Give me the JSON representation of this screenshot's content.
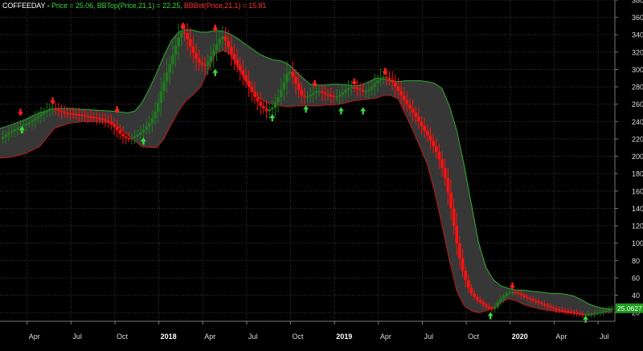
{
  "chart_data": {
    "type": "candlestick",
    "symbol": "COFFEEDAY",
    "legend": [
      {
        "key": "symbol",
        "text": "COFFEEDAY",
        "color": "#ffffff"
      },
      {
        "key": "sep",
        "text": " - ",
        "color": "#ffffff"
      },
      {
        "key": "price",
        "text": "Price = 25.06, ",
        "color": "#3fd43f"
      },
      {
        "key": "bbtop",
        "text": "BBTop(Price,21,1) = 22.25, ",
        "color": "#3fd43f"
      },
      {
        "key": "bbbot",
        "text": "BBBot(Price,21,1) = 15.81",
        "color": "#ff3030"
      }
    ],
    "last_price_label": "25.0627",
    "y_axis": {
      "min": 10,
      "max": 380,
      "ticks": [
        20,
        40,
        60,
        80,
        100,
        120,
        140,
        160,
        180,
        200,
        220,
        240,
        260,
        280,
        300,
        320,
        340,
        360,
        380
      ]
    },
    "x_axis": {
      "ticks": [
        {
          "t": 0.15,
          "label": "Apr",
          "bold": false
        },
        {
          "t": 3.15,
          "label": "Jul",
          "bold": false
        },
        {
          "t": 6.15,
          "label": "Oct",
          "bold": false
        },
        {
          "t": 9.15,
          "label": "2018",
          "bold": true
        },
        {
          "t": 12.15,
          "label": "Apr",
          "bold": false
        },
        {
          "t": 15.15,
          "label": "Jul",
          "bold": false
        },
        {
          "t": 18.15,
          "label": "Oct",
          "bold": false
        },
        {
          "t": 21.15,
          "label": "2019",
          "bold": true
        },
        {
          "t": 24.15,
          "label": "Apr",
          "bold": false
        },
        {
          "t": 27.15,
          "label": "Jul",
          "bold": false
        },
        {
          "t": 30.15,
          "label": "Oct",
          "bold": false
        },
        {
          "t": 33.15,
          "label": "2020",
          "bold": true
        },
        {
          "t": 36.15,
          "label": "Apr",
          "bold": false
        },
        {
          "t": 39.15,
          "label": "Jul",
          "bold": false
        }
      ],
      "t_min": -1.7,
      "t_max": 40.3
    },
    "price": [
      [
        -1.7,
        220
      ],
      [
        -1.2,
        226
      ],
      [
        -0.6,
        232
      ],
      [
        -0.1,
        236
      ],
      [
        0.4,
        240
      ],
      [
        0.9,
        246
      ],
      [
        1.4,
        252
      ],
      [
        1.8,
        256
      ],
      [
        2.2,
        253
      ],
      [
        2.7,
        250
      ],
      [
        3.2,
        249
      ],
      [
        3.7,
        248
      ],
      [
        4.2,
        246
      ],
      [
        4.7,
        245
      ],
      [
        5.2,
        243
      ],
      [
        5.7,
        240
      ],
      [
        6.2,
        232
      ],
      [
        6.6,
        224
      ],
      [
        7.0,
        220
      ],
      [
        7.4,
        222
      ],
      [
        7.8,
        226
      ],
      [
        8.2,
        232
      ],
      [
        8.6,
        240
      ],
      [
        9.0,
        255
      ],
      [
        9.3,
        275
      ],
      [
        9.6,
        292
      ],
      [
        9.9,
        306
      ],
      [
        10.2,
        322
      ],
      [
        10.5,
        337
      ],
      [
        10.8,
        345
      ],
      [
        11.1,
        335
      ],
      [
        11.4,
        322
      ],
      [
        11.7,
        312
      ],
      [
        12.0,
        306
      ],
      [
        12.3,
        304
      ],
      [
        12.6,
        312
      ],
      [
        12.9,
        322
      ],
      [
        13.2,
        333
      ],
      [
        13.5,
        338
      ],
      [
        13.8,
        330
      ],
      [
        14.1,
        318
      ],
      [
        14.5,
        305
      ],
      [
        14.9,
        293
      ],
      [
        15.3,
        280
      ],
      [
        15.7,
        268
      ],
      [
        16.1,
        258
      ],
      [
        16.5,
        252
      ],
      [
        16.9,
        256
      ],
      [
        17.3,
        268
      ],
      [
        17.7,
        285
      ],
      [
        18.0,
        300
      ],
      [
        18.3,
        292
      ],
      [
        18.6,
        280
      ],
      [
        18.9,
        270
      ],
      [
        19.2,
        268
      ],
      [
        19.6,
        272
      ],
      [
        20.0,
        276
      ],
      [
        20.4,
        272
      ],
      [
        20.8,
        270
      ],
      [
        21.2,
        268
      ],
      [
        21.6,
        272
      ],
      [
        22.0,
        278
      ],
      [
        22.4,
        280
      ],
      [
        22.8,
        277
      ],
      [
        23.2,
        274
      ],
      [
        23.6,
        278
      ],
      [
        24.0,
        286
      ],
      [
        24.4,
        292
      ],
      [
        24.8,
        290
      ],
      [
        25.1,
        285
      ],
      [
        25.4,
        278
      ],
      [
        25.7,
        270
      ],
      [
        26.0,
        262
      ],
      [
        26.3,
        255
      ],
      [
        26.6,
        248
      ],
      [
        26.9,
        240
      ],
      [
        27.2,
        232
      ],
      [
        27.5,
        224
      ],
      [
        27.8,
        215
      ],
      [
        28.1,
        205
      ],
      [
        28.4,
        192
      ],
      [
        28.7,
        175
      ],
      [
        29.0,
        150
      ],
      [
        29.3,
        120
      ],
      [
        29.6,
        90
      ],
      [
        29.9,
        68
      ],
      [
        30.2,
        52
      ],
      [
        30.5,
        42
      ],
      [
        30.8,
        36
      ],
      [
        31.1,
        32
      ],
      [
        31.4,
        28
      ],
      [
        31.7,
        25
      ],
      [
        32.0,
        24
      ],
      [
        32.3,
        32
      ],
      [
        32.6,
        38
      ],
      [
        32.9,
        42
      ],
      [
        33.2,
        44
      ],
      [
        33.5,
        43
      ],
      [
        33.8,
        41
      ],
      [
        34.1,
        38
      ],
      [
        34.4,
        36
      ],
      [
        34.7,
        34
      ],
      [
        35.0,
        32
      ],
      [
        35.3,
        30
      ],
      [
        35.6,
        28
      ],
      [
        35.9,
        26
      ],
      [
        36.2,
        24
      ],
      [
        36.5,
        23
      ],
      [
        36.8,
        22
      ],
      [
        37.1,
        21
      ],
      [
        37.4,
        20
      ],
      [
        37.7,
        19
      ],
      [
        38.0,
        18
      ],
      [
        38.3,
        18
      ],
      [
        38.6,
        18
      ],
      [
        38.9,
        19
      ],
      [
        39.2,
        20
      ],
      [
        39.5,
        21
      ],
      [
        39.8,
        23
      ],
      [
        40.1,
        25
      ]
    ],
    "bb_top": [
      [
        -1.7,
        232
      ],
      [
        -1.0,
        236
      ],
      [
        0.0,
        242
      ],
      [
        1.0,
        250
      ],
      [
        2.0,
        255
      ],
      [
        3.0,
        255
      ],
      [
        4.0,
        254
      ],
      [
        5.0,
        253
      ],
      [
        6.0,
        252
      ],
      [
        7.0,
        250
      ],
      [
        7.5,
        252
      ],
      [
        8.0,
        262
      ],
      [
        8.5,
        278
      ],
      [
        9.0,
        296
      ],
      [
        9.5,
        316
      ],
      [
        10.0,
        333
      ],
      [
        10.5,
        343
      ],
      [
        11.0,
        346
      ],
      [
        11.5,
        345
      ],
      [
        12.0,
        343
      ],
      [
        12.5,
        343
      ],
      [
        13.0,
        345
      ],
      [
        13.5,
        344
      ],
      [
        14.0,
        341
      ],
      [
        14.5,
        336
      ],
      [
        15.0,
        330
      ],
      [
        15.5,
        324
      ],
      [
        16.0,
        318
      ],
      [
        16.5,
        314
      ],
      [
        17.0,
        311
      ],
      [
        17.5,
        310
      ],
      [
        18.0,
        306
      ],
      [
        18.5,
        298
      ],
      [
        19.0,
        290
      ],
      [
        19.5,
        283
      ],
      [
        20.0,
        282
      ],
      [
        20.5,
        282
      ],
      [
        21.0,
        283
      ],
      [
        21.5,
        283
      ],
      [
        22.0,
        282
      ],
      [
        22.5,
        281
      ],
      [
        23.0,
        282
      ],
      [
        23.5,
        286
      ],
      [
        24.0,
        290
      ],
      [
        24.5,
        289
      ],
      [
        25.0,
        287
      ],
      [
        25.5,
        286
      ],
      [
        26.0,
        287
      ],
      [
        26.5,
        287
      ],
      [
        27.0,
        287
      ],
      [
        27.5,
        286
      ],
      [
        28.0,
        284
      ],
      [
        28.5,
        278
      ],
      [
        29.0,
        258
      ],
      [
        29.5,
        230
      ],
      [
        30.0,
        190
      ],
      [
        30.5,
        145
      ],
      [
        31.0,
        100
      ],
      [
        31.5,
        72
      ],
      [
        32.0,
        58
      ],
      [
        32.5,
        51
      ],
      [
        33.0,
        48
      ],
      [
        33.5,
        46
      ],
      [
        34.0,
        46
      ],
      [
        34.5,
        45
      ],
      [
        35.0,
        44
      ],
      [
        35.5,
        43
      ],
      [
        36.0,
        42
      ],
      [
        36.5,
        42
      ],
      [
        37.0,
        41
      ],
      [
        37.5,
        39
      ],
      [
        38.0,
        35
      ],
      [
        38.5,
        30
      ],
      [
        39.0,
        27
      ],
      [
        39.5,
        25
      ],
      [
        40.1,
        24
      ]
    ],
    "bb_bot": [
      [
        -1.7,
        198
      ],
      [
        -1.0,
        199
      ],
      [
        0.0,
        203
      ],
      [
        1.0,
        211
      ],
      [
        2.0,
        232
      ],
      [
        3.0,
        238
      ],
      [
        4.0,
        240
      ],
      [
        5.0,
        240
      ],
      [
        6.0,
        238
      ],
      [
        7.0,
        225
      ],
      [
        8.0,
        211
      ],
      [
        9.0,
        210
      ],
      [
        9.5,
        220
      ],
      [
        10.0,
        237
      ],
      [
        10.5,
        252
      ],
      [
        11.0,
        264
      ],
      [
        11.5,
        271
      ],
      [
        12.0,
        280
      ],
      [
        12.5,
        298
      ],
      [
        13.0,
        318
      ],
      [
        13.5,
        322
      ],
      [
        14.0,
        318
      ],
      [
        14.5,
        304
      ],
      [
        15.0,
        289
      ],
      [
        15.5,
        276
      ],
      [
        16.0,
        267
      ],
      [
        16.5,
        262
      ],
      [
        17.0,
        260
      ],
      [
        17.5,
        258
      ],
      [
        18.0,
        257
      ],
      [
        18.5,
        258
      ],
      [
        19.0,
        258
      ],
      [
        19.5,
        258
      ],
      [
        20.0,
        258
      ],
      [
        20.5,
        259
      ],
      [
        21.0,
        259
      ],
      [
        21.5,
        260
      ],
      [
        22.0,
        262
      ],
      [
        22.5,
        264
      ],
      [
        23.0,
        265
      ],
      [
        23.5,
        266
      ],
      [
        24.0,
        267
      ],
      [
        24.5,
        270
      ],
      [
        25.0,
        270
      ],
      [
        25.5,
        266
      ],
      [
        26.0,
        248
      ],
      [
        26.5,
        230
      ],
      [
        27.0,
        210
      ],
      [
        27.5,
        190
      ],
      [
        28.0,
        158
      ],
      [
        28.5,
        120
      ],
      [
        29.0,
        80
      ],
      [
        29.5,
        45
      ],
      [
        30.0,
        28
      ],
      [
        30.5,
        22
      ],
      [
        31.0,
        20
      ],
      [
        31.5,
        22
      ],
      [
        32.0,
        26
      ],
      [
        32.5,
        31
      ],
      [
        33.0,
        36
      ],
      [
        33.5,
        34
      ],
      [
        34.0,
        30
      ],
      [
        34.5,
        27
      ],
      [
        35.0,
        25
      ],
      [
        35.5,
        23
      ],
      [
        36.0,
        22
      ],
      [
        36.5,
        21
      ],
      [
        37.0,
        20
      ],
      [
        37.5,
        19
      ],
      [
        38.0,
        18
      ],
      [
        38.5,
        18
      ],
      [
        39.0,
        19
      ],
      [
        39.5,
        20
      ],
      [
        40.1,
        21
      ]
    ],
    "buy_signals": [
      [
        -0.2,
        230
      ],
      [
        8.1,
        217
      ],
      [
        13.0,
        296
      ],
      [
        16.9,
        244
      ],
      [
        19.2,
        254
      ],
      [
        21.6,
        252
      ],
      [
        23.1,
        252
      ],
      [
        31.8,
        16
      ],
      [
        38.3,
        12
      ]
    ],
    "sell_signals": [
      [
        -0.3,
        251
      ],
      [
        1.9,
        264
      ],
      [
        6.3,
        254
      ],
      [
        10.8,
        350
      ],
      [
        13.0,
        348
      ],
      [
        19.8,
        284
      ],
      [
        22.5,
        286
      ],
      [
        24.6,
        298
      ],
      [
        33.3,
        51
      ]
    ],
    "colors": {
      "up": "#1f7a1f",
      "down": "#ff1010",
      "band_fill": "#3a3a3a",
      "band_top": "#2fae2f",
      "band_bot": "#c01818",
      "buy": "#3fd43f",
      "sell": "#ff2020",
      "grid": "#3a3a3a",
      "axis_text": "#dcdcdc",
      "last_bg": "#1e9e1e"
    }
  }
}
